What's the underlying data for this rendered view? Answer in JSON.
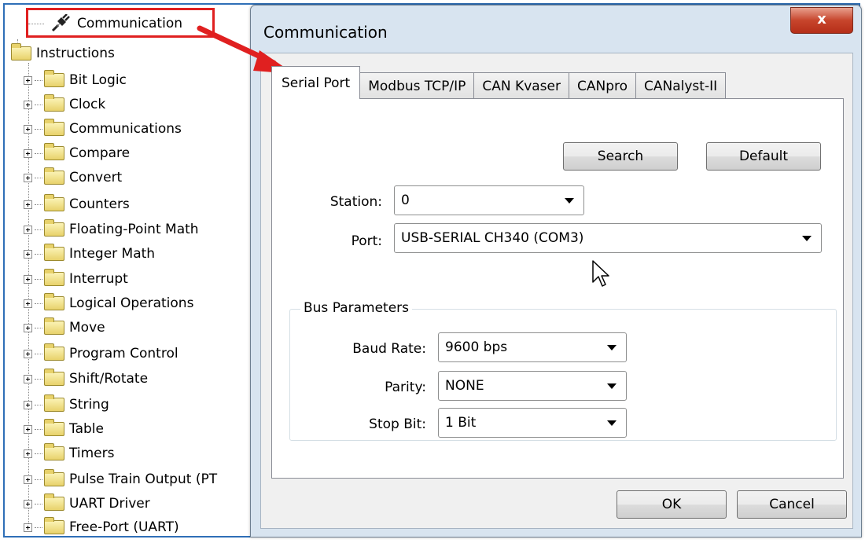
{
  "tree": {
    "communication_label": "Communication",
    "instructions_label": "Instructions",
    "folders": [
      "Bit Logic",
      "Clock",
      "Communications",
      "Compare",
      "Convert",
      "Counters",
      "Floating-Point Math",
      "Integer Math",
      "Interrupt",
      "Logical Operations",
      "Move",
      "Program Control",
      "Shift/Rotate",
      "String",
      "Table",
      "Timers",
      "Pulse Train Output (PT",
      "UART Driver",
      "Free-Port (UART)"
    ]
  },
  "dialog": {
    "title": "Communication",
    "close_label": "x",
    "tabs": [
      "Serial Port",
      "Modbus TCP/IP",
      "CAN Kvaser",
      "CANpro",
      "CANalyst-II"
    ],
    "active_tab": "Serial Port",
    "search_label": "Search",
    "default_label": "Default",
    "station_label": "Station:",
    "station_value": "0",
    "port_label": "Port:",
    "port_value": "USB-SERIAL CH340 (COM3)",
    "bus_parameters_title": "Bus Parameters",
    "baud_rate_label": "Baud Rate:",
    "baud_rate_value": "9600 bps",
    "parity_label": "Parity:",
    "parity_value": "NONE",
    "stop_bit_label": "Stop Bit:",
    "stop_bit_value": "1 Bit",
    "ok_label": "OK",
    "cancel_label": "Cancel"
  },
  "colors": {
    "highlight": "#e02020",
    "window_frame": "#d8e4f0",
    "close_button": "#c7452c",
    "folder": "#e8d26b"
  }
}
